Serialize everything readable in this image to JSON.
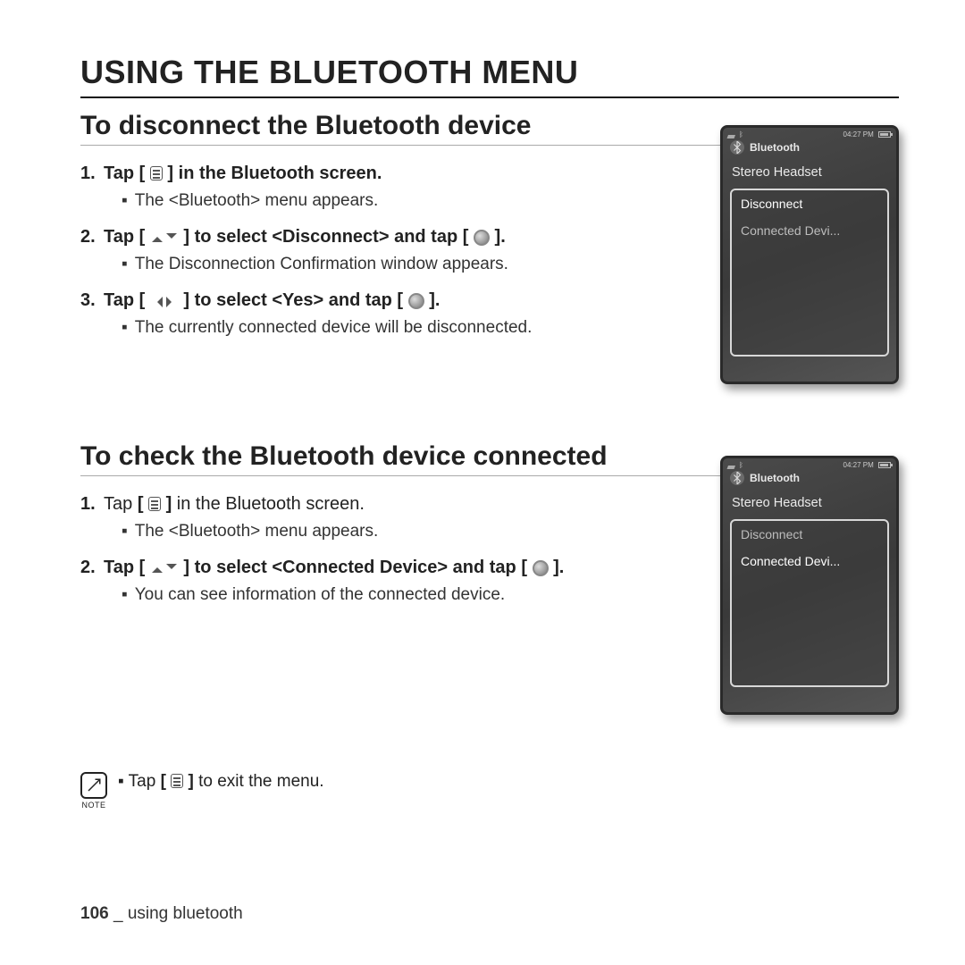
{
  "title": "USING THE BLUETOOTH MENU",
  "sections": [
    {
      "heading": "To disconnect the Bluetooth device",
      "steps": [
        {
          "num": "1.",
          "pre": "Tap ",
          "icon": "menu",
          "post": " in the Bluetooth screen.",
          "bold": true,
          "sub": "The <Bluetooth> menu appears."
        },
        {
          "num": "2.",
          "pre": "Tap ",
          "icon": "updown",
          "mid": " to select ",
          "boldTerm": "<Disconnect>",
          "post2": " and tap ",
          "icon2": "circle",
          "tail": ".",
          "bold": true,
          "sub": "The Disconnection Confirmation window appears."
        },
        {
          "num": "3.",
          "pre": "Tap ",
          "icon": "leftright",
          "mid": " to select ",
          "boldTerm": "<Yes>",
          "post2": " and tap ",
          "icon2": "circle",
          "tail": ".",
          "bold": true,
          "sub": "The currently connected device will be disconnected."
        }
      ],
      "device": {
        "time": "04:27 PM",
        "title": "Bluetooth",
        "header": "Stereo Headset",
        "items": [
          {
            "label": "Disconnect",
            "sel": true
          },
          {
            "label": "Connected Devi...",
            "sel": false
          }
        ]
      }
    },
    {
      "heading": "To check the Bluetooth device connected",
      "steps": [
        {
          "num": "1.",
          "pre": "Tap ",
          "icon": "menu",
          "post": " in the Bluetooth screen.",
          "bold": false,
          "sub": "The <Bluetooth> menu appears."
        },
        {
          "num": "2.",
          "pre": "Tap ",
          "icon": "updown",
          "mid": " to select ",
          "boldTerm": "<Connected Device>",
          "post2": " and tap ",
          "icon2": "circle",
          "tail": ".",
          "wrap": true,
          "bold": true,
          "sub": "You can see information of the connected device."
        }
      ],
      "device": {
        "time": "04:27 PM",
        "title": "Bluetooth",
        "header": "Stereo Headset",
        "items": [
          {
            "label": "Disconnect",
            "sel": false
          },
          {
            "label": "Connected Devi...",
            "sel": true
          }
        ]
      }
    }
  ],
  "note": {
    "label": "NOTE",
    "pre": "Tap ",
    "icon": "menu",
    "post": " to exit the menu."
  },
  "footer": {
    "page": "106",
    "sep": " _ ",
    "chapter": "using bluetooth"
  }
}
